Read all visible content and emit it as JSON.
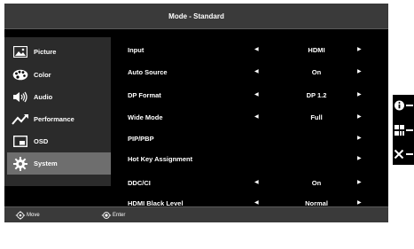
{
  "window": {
    "title": "Mode - Standard"
  },
  "sidebar": {
    "items": [
      {
        "label": "Picture",
        "icon": "picture-icon"
      },
      {
        "label": "Color",
        "icon": "palette-icon"
      },
      {
        "label": "Audio",
        "icon": "speaker-icon"
      },
      {
        "label": "Performance",
        "icon": "trend-icon"
      },
      {
        "label": "OSD",
        "icon": "osd-icon"
      },
      {
        "label": "System",
        "icon": "gear-icon",
        "selected": true
      }
    ]
  },
  "settings": [
    {
      "label": "Input",
      "value": "HDMI",
      "left_arrow": true,
      "right_arrow": true
    },
    {
      "label": "Auto Source",
      "value": "On",
      "left_arrow": true,
      "right_arrow": true
    },
    {
      "label": "DP Format",
      "value": "DP 1.2",
      "left_arrow": true,
      "right_arrow": true
    },
    {
      "label": "Wide Mode",
      "value": "Full",
      "left_arrow": true,
      "right_arrow": true
    },
    {
      "label": "PIP/PBP",
      "value": "",
      "left_arrow": false,
      "right_arrow": true
    },
    {
      "label": "Hot Key Assignment",
      "value": "",
      "left_arrow": false,
      "right_arrow": true
    },
    {
      "label": "DDC/CI",
      "value": "On",
      "left_arrow": true,
      "right_arrow": true
    },
    {
      "label": "HDMI Black Level",
      "value": "Normal",
      "left_arrow": true,
      "right_arrow": true
    }
  ],
  "glyphs": {
    "left": "◀",
    "right": "▶",
    "down": "▼"
  },
  "footer": {
    "move": "Move",
    "enter": "Enter"
  },
  "keys": [
    "info-key-icon",
    "menu-key-icon",
    "exit-key-icon"
  ],
  "colors": {
    "panel": "#000000",
    "bar": "#3a3a3a",
    "sidebar": "#2b2b2b",
    "selected": "#6e6e6e",
    "text": "#ffffff"
  }
}
